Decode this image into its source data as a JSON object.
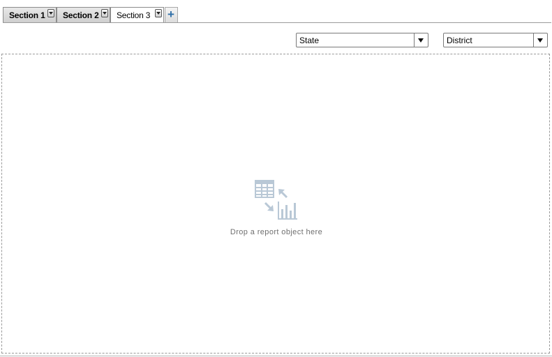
{
  "tabs": [
    {
      "label": "Section 1",
      "active": false
    },
    {
      "label": "Section 2",
      "active": false
    },
    {
      "label": "Section 3",
      "active": true
    }
  ],
  "add_tab": {
    "label": "+"
  },
  "filters": {
    "state": {
      "value": "State"
    },
    "district": {
      "value": "District"
    }
  },
  "dropzone": {
    "message": "Drop a report object here",
    "icon": "table-to-chart-icon"
  },
  "colors": {
    "accent": "#2f6fa8",
    "icon": "#b9c8d6",
    "dashed_border": "#9a9a9a"
  }
}
